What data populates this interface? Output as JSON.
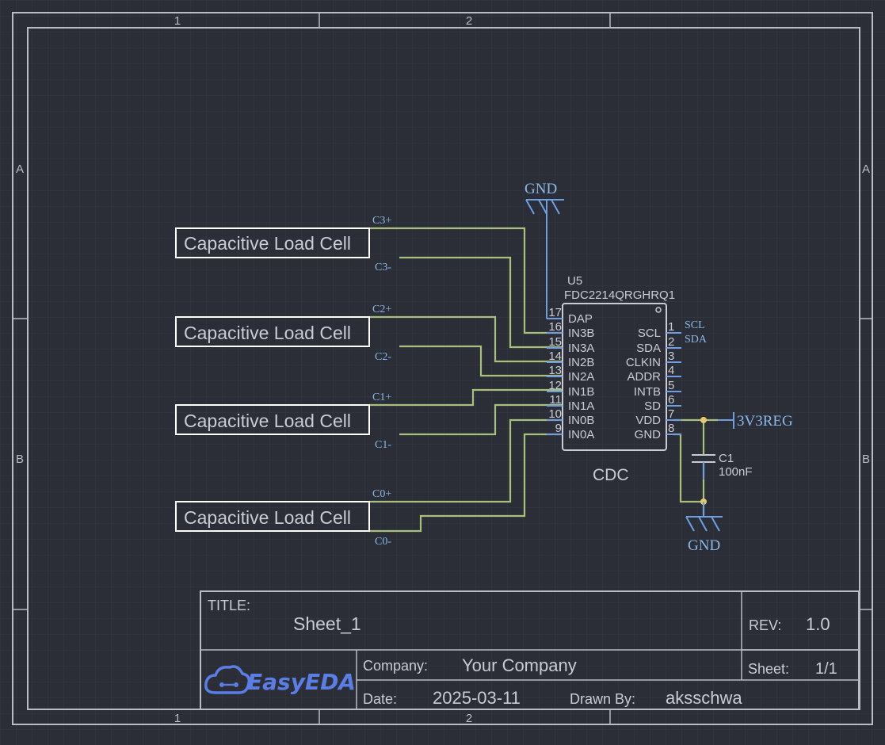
{
  "frame": {
    "col_labels": [
      "1",
      "2"
    ],
    "row_labels": [
      "A",
      "B"
    ]
  },
  "blocks": [
    {
      "label": "Capacitive Load Cell",
      "pos_net": "C3+",
      "neg_net": "C3-"
    },
    {
      "label": "Capacitive Load Cell",
      "pos_net": "C2+",
      "neg_net": "C2-"
    },
    {
      "label": "Capacitive Load Cell",
      "pos_net": "C1+",
      "neg_net": "C1-"
    },
    {
      "label": "Capacitive Load Cell",
      "pos_net": "C0+",
      "neg_net": "C0-"
    }
  ],
  "ic": {
    "designator": "U5",
    "part": "FDC2214QRGHRQ1",
    "name": "CDC",
    "left_pins": [
      {
        "num": "17",
        "name": "DAP"
      },
      {
        "num": "16",
        "name": "IN3B"
      },
      {
        "num": "15",
        "name": "IN3A"
      },
      {
        "num": "14",
        "name": "IN2B"
      },
      {
        "num": "13",
        "name": "IN2A"
      },
      {
        "num": "12",
        "name": "IN1B"
      },
      {
        "num": "11",
        "name": "IN1A"
      },
      {
        "num": "10",
        "name": "IN0B"
      },
      {
        "num": "9",
        "name": "IN0A"
      }
    ],
    "right_pins": [
      {
        "num": "1",
        "name": "SCL"
      },
      {
        "num": "2",
        "name": "SDA"
      },
      {
        "num": "3",
        "name": "CLKIN"
      },
      {
        "num": "4",
        "name": "ADDR"
      },
      {
        "num": "5",
        "name": "INTB"
      },
      {
        "num": "6",
        "name": "SD"
      },
      {
        "num": "7",
        "name": "VDD"
      },
      {
        "num": "8",
        "name": "GND"
      }
    ]
  },
  "nets": {
    "scl": "SCL",
    "sda": "SDA",
    "gnd_top": "GND",
    "gnd_bottom": "GND",
    "power": "3V3REG"
  },
  "capacitor": {
    "designator": "C1",
    "value": "100nF"
  },
  "title_block": {
    "title_label": "TITLE:",
    "title_value": "Sheet_1",
    "rev_label": "REV:",
    "rev_value": "1.0",
    "company_label": "Company:",
    "company_value": "Your Company",
    "sheet_label": "Sheet:",
    "sheet_value": "1/1",
    "date_label": "Date:",
    "date_value": "2025-03-11",
    "drawn_label": "Drawn By:",
    "drawn_value": "aksschwa",
    "logo": "EasyEDA"
  },
  "colors": {
    "background": "#2b2e37",
    "wire": "#a8c07a",
    "pin": "#6f9fe0",
    "net_label": "#8ab8e8",
    "logo": "#5b7ee5"
  }
}
